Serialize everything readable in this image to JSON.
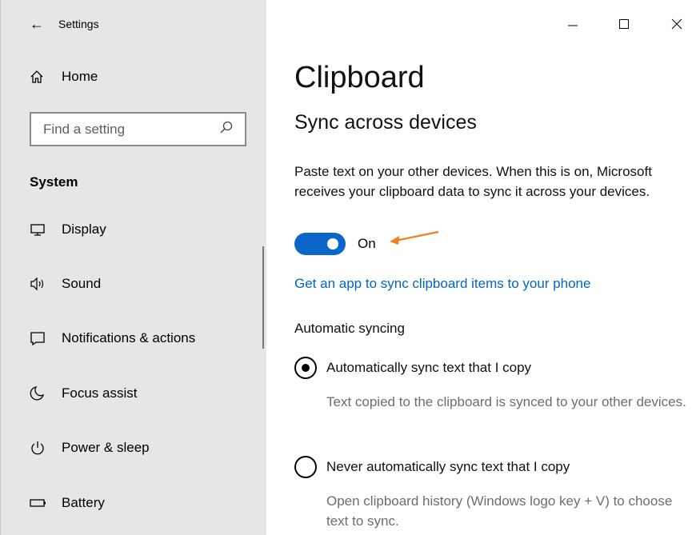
{
  "window": {
    "app_title": "Settings",
    "minimize_glyph": "—",
    "maximize_glyph": "☐",
    "close_glyph": "✕"
  },
  "sidebar": {
    "home_label": "Home",
    "search_placeholder": "Find a setting",
    "section_label": "System",
    "items": [
      {
        "label": "Display",
        "icon": "display-icon"
      },
      {
        "label": "Sound",
        "icon": "speaker-icon"
      },
      {
        "label": "Notifications & actions",
        "icon": "notification-icon"
      },
      {
        "label": "Focus assist",
        "icon": "moon-icon"
      },
      {
        "label": "Power & sleep",
        "icon": "power-icon"
      },
      {
        "label": "Battery",
        "icon": "battery-icon"
      }
    ]
  },
  "main": {
    "title": "Clipboard",
    "subtitle": "Sync across devices",
    "description": "Paste text on your other devices. When this is on, Microsoft receives your clipboard data to sync it across your devices.",
    "toggle": {
      "state": "on",
      "label": "On"
    },
    "link": "Get an app to sync clipboard items to your phone",
    "auto_heading": "Automatic syncing",
    "options": [
      {
        "label": "Automatically sync text that I copy",
        "description": "Text copied to the clipboard is synced to your other devices.",
        "checked": true
      },
      {
        "label": "Never automatically sync text that I copy",
        "description": "Open clipboard history (Windows logo key + V) to choose text to sync.",
        "checked": false
      }
    ]
  },
  "colors": {
    "accent": "#0a67c8",
    "link": "#0067c0",
    "sidebar_bg": "#e6e6e6",
    "annotation_arrow": "#f07f1a"
  }
}
